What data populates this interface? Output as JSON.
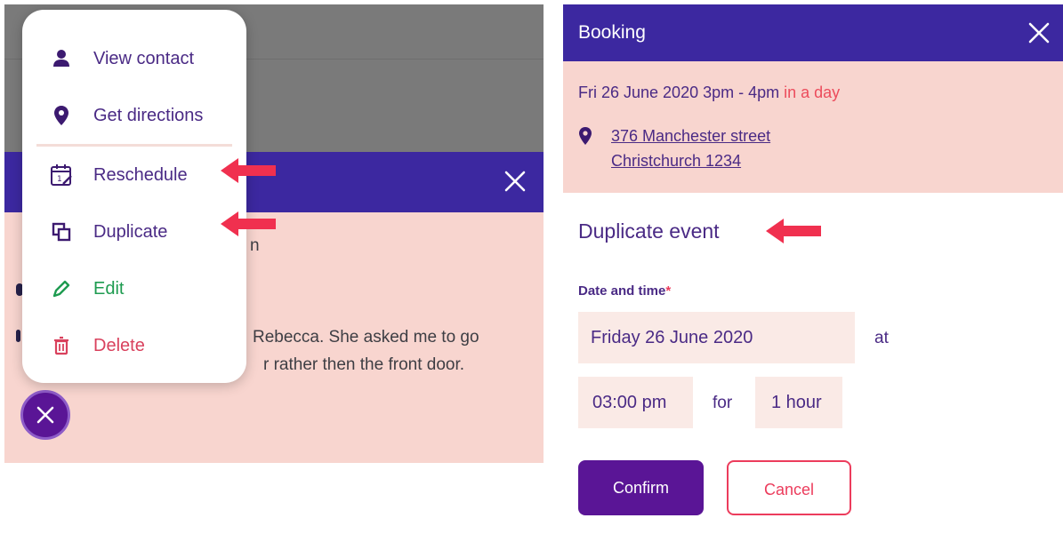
{
  "left": {
    "background_text": {
      "line_top": "n",
      "line_mid": "Rebecca. She asked me to go",
      "line_bottom": "r rather then the front door."
    },
    "menu": {
      "items": [
        {
          "label": "View contact",
          "icon": "person-icon"
        },
        {
          "label": "Get directions",
          "icon": "location-pin-icon"
        },
        {
          "label": "Reschedule",
          "icon": "calendar-edit-icon"
        },
        {
          "label": "Duplicate",
          "icon": "duplicate-icon"
        },
        {
          "label": "Edit",
          "icon": "pencil-icon"
        },
        {
          "label": "Delete",
          "icon": "trash-icon"
        }
      ]
    },
    "fab_icon": "close-icon"
  },
  "right": {
    "header": {
      "title": "Booking"
    },
    "info": {
      "date_range": "Fri 26 June 2020 3pm - 4pm",
      "relative": "in a day",
      "address_line1": "376 Manchester street",
      "address_line2": "Christchurch 1234"
    },
    "form": {
      "section_title": "Duplicate event",
      "label": "Date and time",
      "required_mark": "*",
      "date_value": "Friday 26 June 2020",
      "at_text": "at",
      "time_value": "03:00 pm",
      "for_text": "for",
      "duration_value": "1 hour"
    },
    "buttons": {
      "confirm": "Confirm",
      "cancel": "Cancel"
    }
  },
  "colors": {
    "header": "#3c28a0",
    "info_bg": "#f8d5cf",
    "text_purple": "#4a2a85",
    "accent_red": "#ec3c5c",
    "edit_green": "#1e9b50",
    "delete_red": "#d9415d",
    "primary_button": "#5a1596",
    "annotation_arrow": "#f0304f"
  }
}
